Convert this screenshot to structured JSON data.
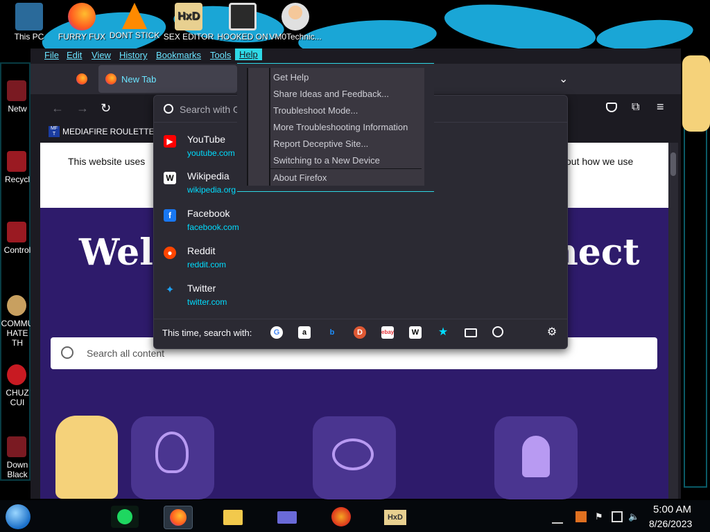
{
  "desktop": {
    "top_icons": [
      {
        "label": "This PC",
        "icon": "this-pc-icon",
        "color": "#3a8fd8"
      },
      {
        "label": "FURRY FUX",
        "icon": "firefox-icon",
        "color": "#ff7a18"
      },
      {
        "label": "DONT STICK",
        "icon": "vlc-cone-icon",
        "color": "#ff8a00"
      },
      {
        "label": "SEX EDITOR",
        "icon": "hxd-editor-icon",
        "color": "#d8c060"
      },
      {
        "label": "HOOKED ON",
        "icon": "game-icon",
        "color": "#404040"
      },
      {
        "label": "VM0Technic...",
        "icon": "doctor-icon",
        "color": "#f0c090"
      }
    ],
    "left_icons": [
      {
        "label": "Netw",
        "icon": "network-icon"
      },
      {
        "label": "Recycl",
        "icon": "recycle-bin-icon"
      },
      {
        "label": "Control",
        "icon": "control-panel-icon"
      },
      {
        "label": "COMMU HATE TH",
        "icon": "money-bag-icon"
      },
      {
        "label": "CHUZ CUI",
        "icon": "red-creature-icon"
      },
      {
        "label": "Down Black",
        "icon": "download-icon"
      }
    ]
  },
  "firefox": {
    "menubar": [
      "File",
      "Edit",
      "View",
      "History",
      "Bookmarks",
      "Tools",
      "Help"
    ],
    "tab": {
      "title": "New Tab"
    },
    "bookmark_bar": {
      "item": "MEDIAFIRE ROULETTER"
    },
    "page": {
      "cookie_text_left": "This website uses",
      "cookie_text_right": "out how we use",
      "hero_left": "Welc",
      "hero_right": "nect",
      "search_placeholder": "Search all content"
    },
    "url_dropdown": {
      "search_placeholder": "Search with G",
      "suggestions": [
        {
          "title": "YouTube",
          "url": "youtube.com",
          "icon": "youtube-icon"
        },
        {
          "title": "Wikipedia",
          "url": "wikipedia.org",
          "icon": "wikipedia-icon"
        },
        {
          "title": "Facebook",
          "url": "facebook.com",
          "icon": "facebook-icon"
        },
        {
          "title": "Reddit",
          "url": "reddit.com",
          "icon": "reddit-icon"
        },
        {
          "title": "Twitter",
          "url": "twitter.com",
          "icon": "twitter-icon"
        }
      ],
      "search_with_label": "This time, search with:",
      "engines": [
        "google-icon",
        "amazon-icon",
        "bing-icon",
        "duckduckgo-icon",
        "ebay-icon",
        "wikipedia-icon",
        "bookmarks-star-icon",
        "tabs-icon",
        "history-icon"
      ]
    },
    "help_menu": {
      "items": [
        "Get Help",
        "Share Ideas and Feedback...",
        "Troubleshoot Mode...",
        "More Troubleshooting Information",
        "Report Deceptive Site...",
        "Switching to a New Device",
        "About Firefox"
      ]
    }
  },
  "taskbar": {
    "time": "5:00 AM",
    "date": "8/26/2023",
    "apps": [
      "spotify-icon",
      "firefox-icon",
      "file-explorer-icon",
      "card-icon",
      "picsart-icon",
      "hxd-icon"
    ]
  },
  "colors": {
    "accent": "#00ddff",
    "menu_text": "#6be4ff",
    "panel_bg": "#2b2a33",
    "purple_bg": "#2e1b6b"
  }
}
